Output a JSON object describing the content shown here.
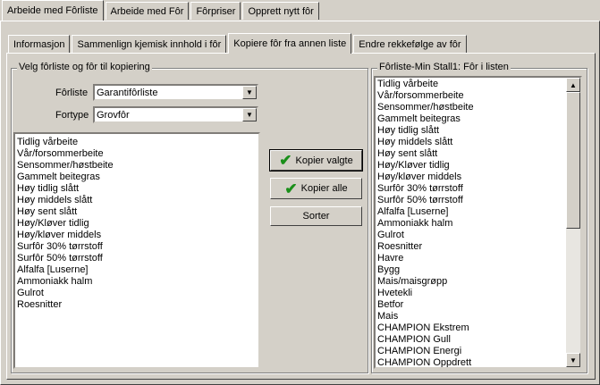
{
  "top_tabs": [
    {
      "label": "Arbeide med Fôrliste"
    },
    {
      "label": "Arbeide med Fôr"
    },
    {
      "label": "Fôrpriser"
    },
    {
      "label": "Opprett nytt fôr"
    }
  ],
  "sub_tabs": [
    {
      "label": "Informasjon"
    },
    {
      "label": "Sammenlign kjemisk innhold i fôr"
    },
    {
      "label": "Kopiere fôr fra annen liste"
    },
    {
      "label": "Endre rekkefølge av fôr"
    }
  ],
  "left_group": {
    "title": "Velg fôrliste og fôr til kopiering",
    "forliste_label": "Fôrliste",
    "forliste_value": "Garantifôrliste",
    "fortype_label": "Fortype",
    "fortype_value": "Grovfôr",
    "items": [
      "Tidlig vårbeite",
      "Vår/forsommerbeite",
      "Sensommer/høstbeite",
      "Gammelt beitegras",
      "Høy tidlig slått",
      "Høy middels slått",
      "Høy sent slått",
      "Høy/Kløver tidlig",
      "Høy/kløver middels",
      "Surfôr 30% tørrstoff",
      "Surfôr 50% tørrstoff",
      "Alfalfa [Luserne]",
      "Ammoniakk halm",
      "Gulrot",
      "Roesnitter"
    ]
  },
  "buttons": {
    "copy_selected": "Kopier valgte",
    "copy_all": "Kopier alle",
    "sort": "Sorter"
  },
  "right_group": {
    "title": "Fôrliste-Min Stall1: Fôr i listen",
    "items": [
      "Tidlig vårbeite",
      "Vår/forsommerbeite",
      "Sensommer/høstbeite",
      "Gammelt beitegras",
      "Høy tidlig slått",
      "Høy middels slått",
      "Høy sent slått",
      "Høy/Kløver tidlig",
      "Høy/kløver middels",
      "Surfôr 30% tørrstoff",
      "Surfôr 50% tørrstoff",
      "Alfalfa [Luserne]",
      "Ammoniakk halm",
      "Gulrot",
      "Roesnitter",
      "Havre",
      "Bygg",
      "Mais/maisgrøpp",
      "Hvetekli",
      "Betfor",
      "Mais",
      "CHAMPION Ekstrem",
      "CHAMPION Gull",
      "CHAMPION Energi",
      "CHAMPION Oppdrett"
    ]
  }
}
